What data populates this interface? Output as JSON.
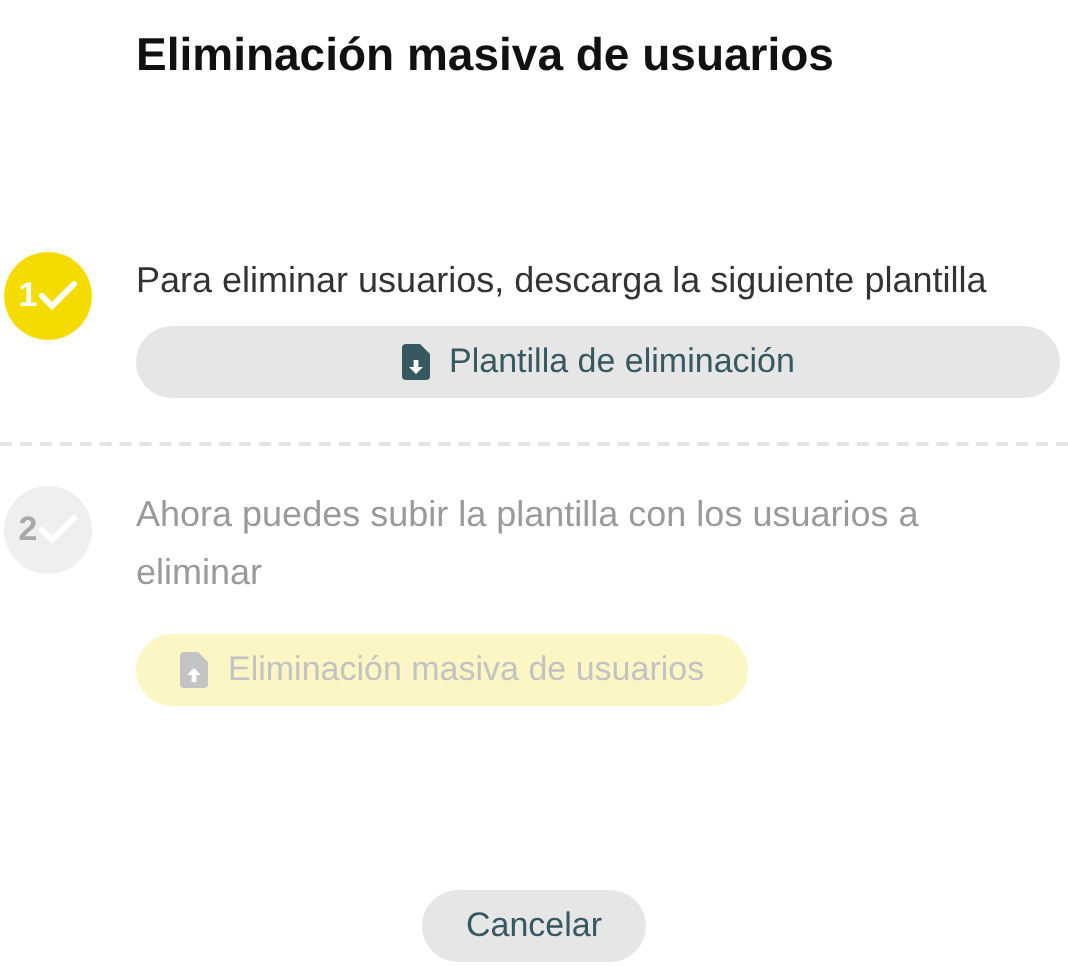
{
  "title": "Eliminación masiva de usuarios",
  "steps": [
    {
      "number": "1",
      "active": true,
      "text": "Para eliminar usuarios, descarga la siguiente plantilla",
      "button": {
        "label": "Plantilla de eliminación",
        "kind": "download",
        "disabled": false
      }
    },
    {
      "number": "2",
      "active": false,
      "text": "Ahora puedes subir la plantilla con los usuarios a eliminar",
      "button": {
        "label": "Eliminación masiva de usuarios",
        "kind": "upload",
        "disabled": true
      }
    }
  ],
  "cancel": {
    "label": "Cancelar"
  }
}
